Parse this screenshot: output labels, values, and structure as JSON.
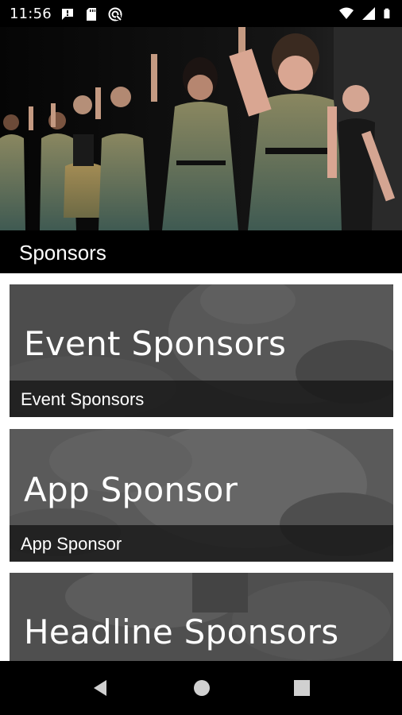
{
  "status_bar": {
    "time": "11:56",
    "left_icons": [
      "message-icon",
      "sd-card-icon",
      "data-saver-icon"
    ],
    "right_icons": [
      "wifi-icon",
      "signal-icon",
      "battery-icon"
    ]
  },
  "header": {
    "title": "Sponsors"
  },
  "cards": [
    {
      "heading": "Event Sponsors",
      "caption": "Event Sponsors"
    },
    {
      "heading": "App Sponsor",
      "caption": "App Sponsor"
    },
    {
      "heading": "Headline Sponsors",
      "caption": ""
    }
  ],
  "nav_bar": {
    "buttons": [
      "back-icon",
      "home-icon",
      "recents-icon"
    ]
  },
  "colors": {
    "status_bar_bg": "#000000",
    "header_bg": "#000000",
    "card_bg": "#555555",
    "caption_bar_bg": "#1e1e1e",
    "text": "#ffffff"
  }
}
